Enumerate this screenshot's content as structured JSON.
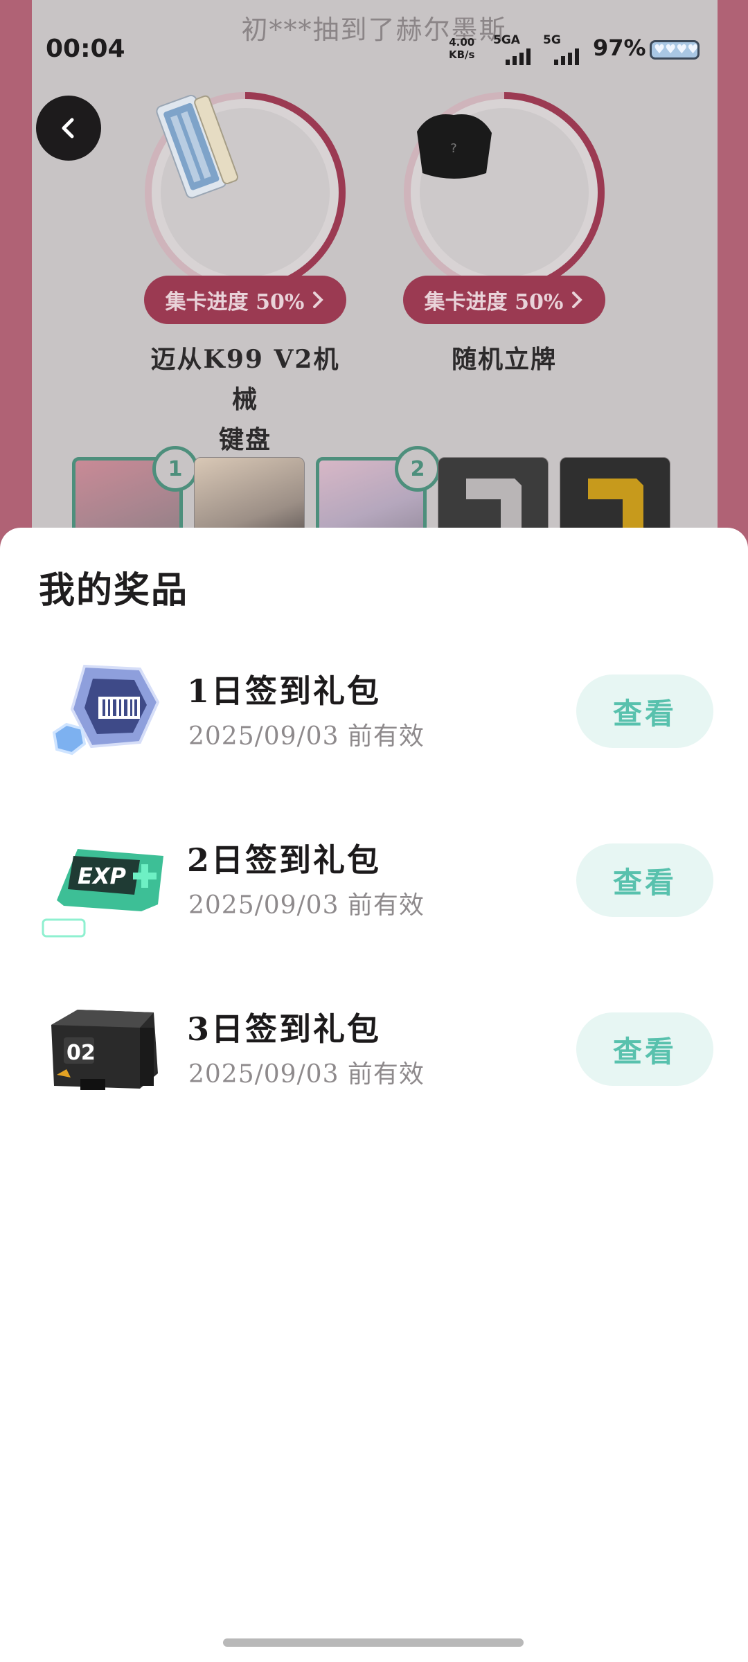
{
  "status_bar": {
    "time": "00:04",
    "net_speed_value": "4.00",
    "net_speed_unit": "KB/s",
    "signal1_label": "5GA",
    "signal2_label": "5G",
    "battery_percent": "97%"
  },
  "background": {
    "ticker": "初***抽到了赫尔墨斯",
    "prizes": [
      {
        "progress_label": "集卡进度 50%",
        "progress_fraction": 0.5,
        "name_line1": "迈从K99 V2机械",
        "name_line2": "键盘",
        "icon": "keyboard-image"
      },
      {
        "progress_label": "集卡进度 50%",
        "progress_fraction": 0.5,
        "name_line1": "随机立牌",
        "name_line2": "",
        "icon": "mystery-stand-image"
      }
    ],
    "char_badges": [
      "1",
      "2"
    ],
    "colors": {
      "accent": "#9b3a52",
      "frame": "#b06275",
      "owned_border": "#4d8f7c"
    }
  },
  "sheet": {
    "title": "我的奖品",
    "items": [
      {
        "name": "1日签到礼包",
        "valid_until": "2025/09/03 前有效",
        "button": "查看",
        "icon": "crystal-card-icon"
      },
      {
        "name": "2日签到礼包",
        "valid_until": "2025/09/03 前有效",
        "button": "查看",
        "icon": "exp-card-icon"
      },
      {
        "name": "3日签到礼包",
        "valid_until": "2025/09/03 前有效",
        "button": "查看",
        "icon": "supply-box-icon"
      }
    ],
    "colors": {
      "button_bg": "#e7f6f3",
      "button_text": "#58c1ad"
    }
  }
}
